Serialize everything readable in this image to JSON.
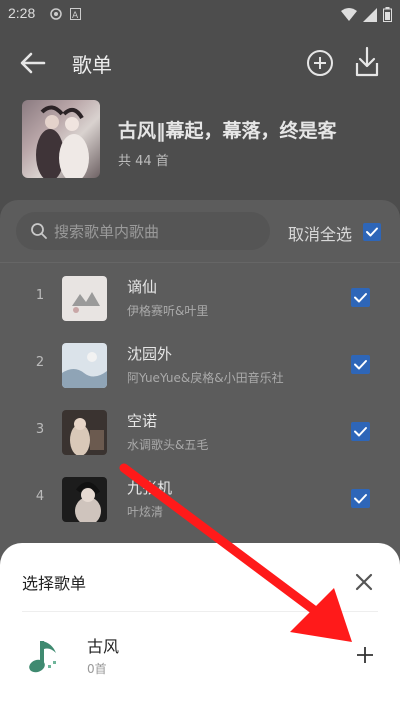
{
  "status_bar": {
    "time": "2:28"
  },
  "header": {
    "title": "歌单",
    "playlist_name": "古风‖幕起，幕落，终是客",
    "playlist_count": "共 44 首"
  },
  "toolbar": {
    "search_placeholder": "搜索歌单内歌曲",
    "cancel_select_all": "取消全选"
  },
  "songs": [
    {
      "index": "1",
      "title": "谪仙",
      "artist": "伊格赛听&叶里",
      "checked": true
    },
    {
      "index": "2",
      "title": "沈园外",
      "artist": "阿YueYue&戾格&小田音乐社",
      "checked": true
    },
    {
      "index": "3",
      "title": "空诺",
      "artist": "水调歌头&五毛",
      "checked": true
    },
    {
      "index": "4",
      "title": "九张机",
      "artist": "叶炫清",
      "checked": true
    }
  ],
  "dialog": {
    "title": "选择歌单",
    "choices": [
      {
        "name": "古风",
        "count": "0首"
      }
    ]
  },
  "colors": {
    "check_blue": "#2e66b8",
    "annotation_red": "#ff1a1a"
  }
}
